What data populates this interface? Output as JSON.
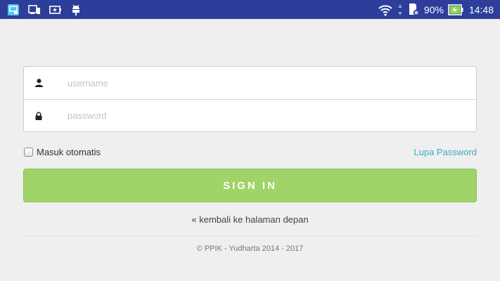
{
  "status_bar": {
    "battery_percent": "90%",
    "time": "14:48",
    "colors": {
      "background": "#2d3e9a",
      "battery_charge": "#8ed84a"
    },
    "icons": [
      "screen-cast-icon",
      "device-icon",
      "battery-charging-icon",
      "android-icon",
      "wifi-icon",
      "data-arrows-icon",
      "sd-card-icon",
      "battery-icon"
    ]
  },
  "login": {
    "username_placeholder": "username",
    "password_placeholder": "password",
    "remember_label": "Masuk otomatis",
    "remember_checked": false,
    "forgot_label": "Lupa Password",
    "signin_label": "SIGN IN",
    "back_label": "« kembali ke halaman depan",
    "footer_text": "© PPIK - Yudharta 2014 - 2017"
  },
  "colors": {
    "page_background": "#efefef",
    "signin_button": "#a0d469",
    "link": "#3fa9c4"
  }
}
